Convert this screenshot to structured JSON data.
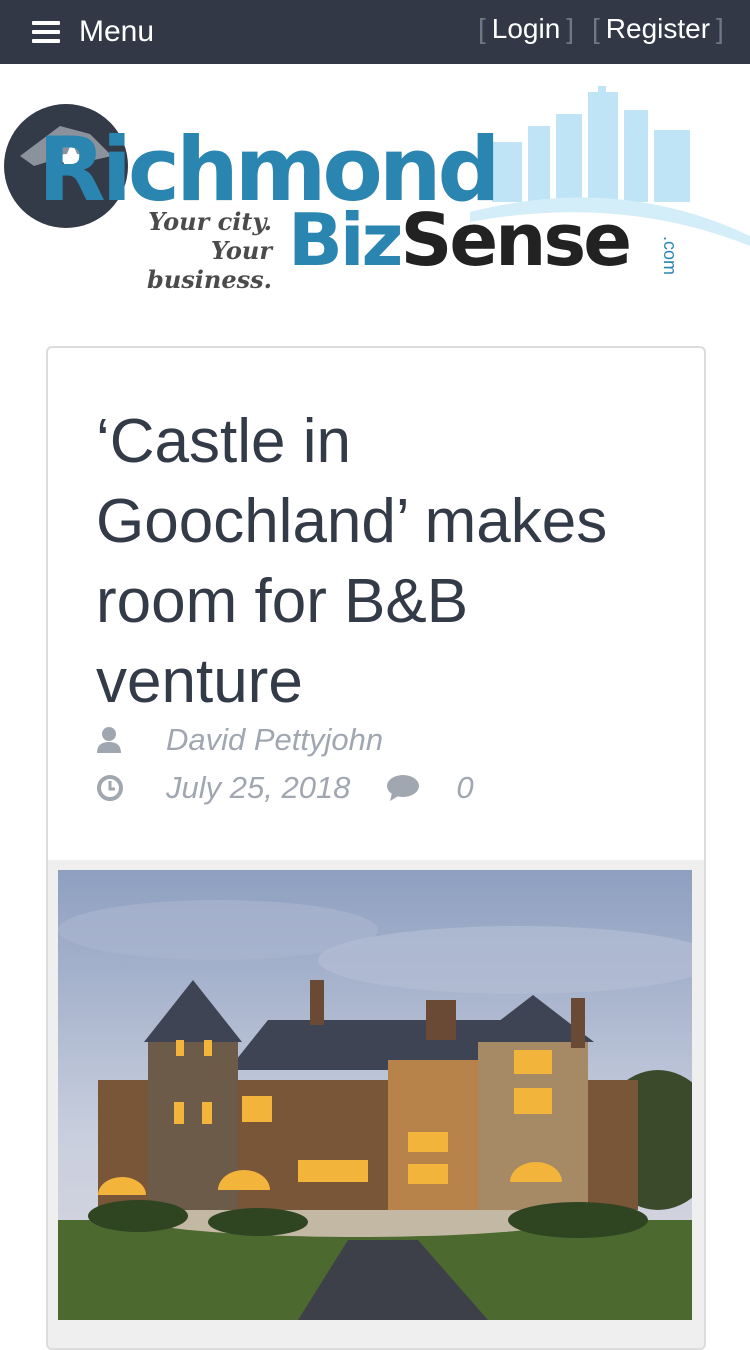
{
  "nav": {
    "menu_label": "Menu",
    "login_label": "Login",
    "register_label": "Register",
    "bracket_open": "[",
    "bracket_close": "]"
  },
  "logo": {
    "richmond": "Richmond",
    "biz": "Biz",
    "sense": "Sense",
    "dotcom": ".com",
    "tagline_line1": "Your city.",
    "tagline_line2": "Your business."
  },
  "article": {
    "title": "‘Castle in Goochland’ makes room for B&B venture",
    "author": "David Pettyjohn",
    "date": "July 25, 2018",
    "comment_count": "0"
  },
  "colors": {
    "topbar": "#323846",
    "brand_blue": "#2b85b1",
    "meta_gray": "#a1a7b1",
    "title_color": "#333a48"
  },
  "icons": [
    "hamburger-icon",
    "user-icon",
    "clock-icon",
    "comment-icon"
  ]
}
